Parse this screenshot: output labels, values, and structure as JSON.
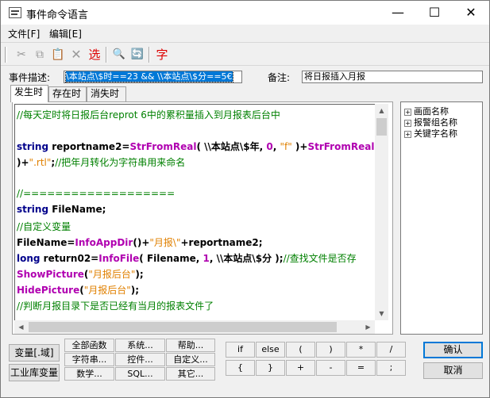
{
  "window": {
    "title": "事件命令语言",
    "minimize": "—",
    "maximize": "☐",
    "close": "✕"
  },
  "menu": [
    "文件[F]",
    "编辑[E]"
  ],
  "toolbar": {
    "icons": [
      "cut-icon",
      "copy-icon",
      "paste-icon",
      "delete-icon",
      "select-icon",
      "find-icon",
      "replace-icon",
      "font-icon"
    ],
    "select_label": "选",
    "font_label": "字"
  },
  "event_desc": {
    "label": "事件描述:",
    "value": "\\本站点\\$时==23  &&  \\\\本站点\\$分==5€"
  },
  "remark": {
    "label": "备注:",
    "value": "将日报插入月报"
  },
  "tabs": [
    "发生时",
    "存在时",
    "消失时"
  ],
  "code_lines": [
    [
      {
        "t": "//每天定时将日报后台reprot 6中的累积量插入到月报表后台中",
        "c": "c-green"
      }
    ],
    [],
    [
      {
        "t": "string ",
        "c": "c-blue"
      },
      {
        "t": "reportname2=",
        "c": "c-black"
      },
      {
        "t": "StrFromReal",
        "c": "c-magenta"
      },
      {
        "t": "( \\\\本站点\\$年, ",
        "c": "c-black"
      },
      {
        "t": "0",
        "c": "c-magenta"
      },
      {
        "t": ", ",
        "c": "c-black"
      },
      {
        "t": "\"f\"",
        "c": "c-orange"
      },
      {
        "t": " )+",
        "c": "c-black"
      },
      {
        "t": "StrFromReal",
        "c": "c-magenta"
      },
      {
        "t": "( \\",
        "c": "c-black"
      }
    ],
    [
      {
        "t": ")+",
        "c": "c-black"
      },
      {
        "t": "\".rtl\"",
        "c": "c-orange"
      },
      {
        "t": ";",
        "c": "c-black"
      },
      {
        "t": "//把年月转化为字符串用来命名",
        "c": "c-green"
      }
    ],
    [],
    [
      {
        "t": "//===================",
        "c": "c-green"
      }
    ],
    [
      {
        "t": "string ",
        "c": "c-blue"
      },
      {
        "t": "FileName;",
        "c": "c-black"
      }
    ],
    [
      {
        "t": "//自定义变量",
        "c": "c-green"
      }
    ],
    [
      {
        "t": "FileName=",
        "c": "c-black"
      },
      {
        "t": "InfoAppDir",
        "c": "c-magenta"
      },
      {
        "t": "()+",
        "c": "c-black"
      },
      {
        "t": "\"月报\\\"",
        "c": "c-orange"
      },
      {
        "t": "+reportname2;",
        "c": "c-black"
      }
    ],
    [
      {
        "t": "long ",
        "c": "c-blue"
      },
      {
        "t": "return02=",
        "c": "c-black"
      },
      {
        "t": "InfoFile",
        "c": "c-magenta"
      },
      {
        "t": "( Filename, ",
        "c": "c-black"
      },
      {
        "t": "1",
        "c": "c-magenta"
      },
      {
        "t": ", \\\\本站点\\$分 );",
        "c": "c-black"
      },
      {
        "t": "//查找文件是否存",
        "c": "c-green"
      }
    ],
    [
      {
        "t": "ShowPicture",
        "c": "c-magenta"
      },
      {
        "t": "(",
        "c": "c-black"
      },
      {
        "t": "\"月报后台\"",
        "c": "c-orange"
      },
      {
        "t": ");",
        "c": "c-black"
      }
    ],
    [
      {
        "t": "HidePicture",
        "c": "c-magenta"
      },
      {
        "t": "(",
        "c": "c-black"
      },
      {
        "t": "\"月报后台\"",
        "c": "c-orange"
      },
      {
        "t": ");",
        "c": "c-black"
      }
    ],
    [
      {
        "t": "//判断月报目录下是否已经有当月的报表文件了",
        "c": "c-green"
      }
    ],
    [
      {
        "t": "                                  ",
        "c": "c-green"
      }
    ]
  ],
  "tree": [
    "画面名称",
    "报警组名称",
    "关键字名称"
  ],
  "tree_expander": "+",
  "left_buttons": [
    "变量[.域]",
    "工业库变量"
  ],
  "func_buttons": [
    [
      "全部函数",
      "系统...",
      "帮助..."
    ],
    [
      "字符串...",
      "控件...",
      "自定义..."
    ],
    [
      "数学...",
      "SQL...",
      "其它..."
    ]
  ],
  "op_buttons": [
    [
      "if",
      "else",
      "(",
      ")",
      "*",
      "/"
    ],
    [
      "{",
      "}",
      "+",
      "-",
      "=",
      ";"
    ]
  ],
  "confirm": "确认",
  "cancel": "取消"
}
